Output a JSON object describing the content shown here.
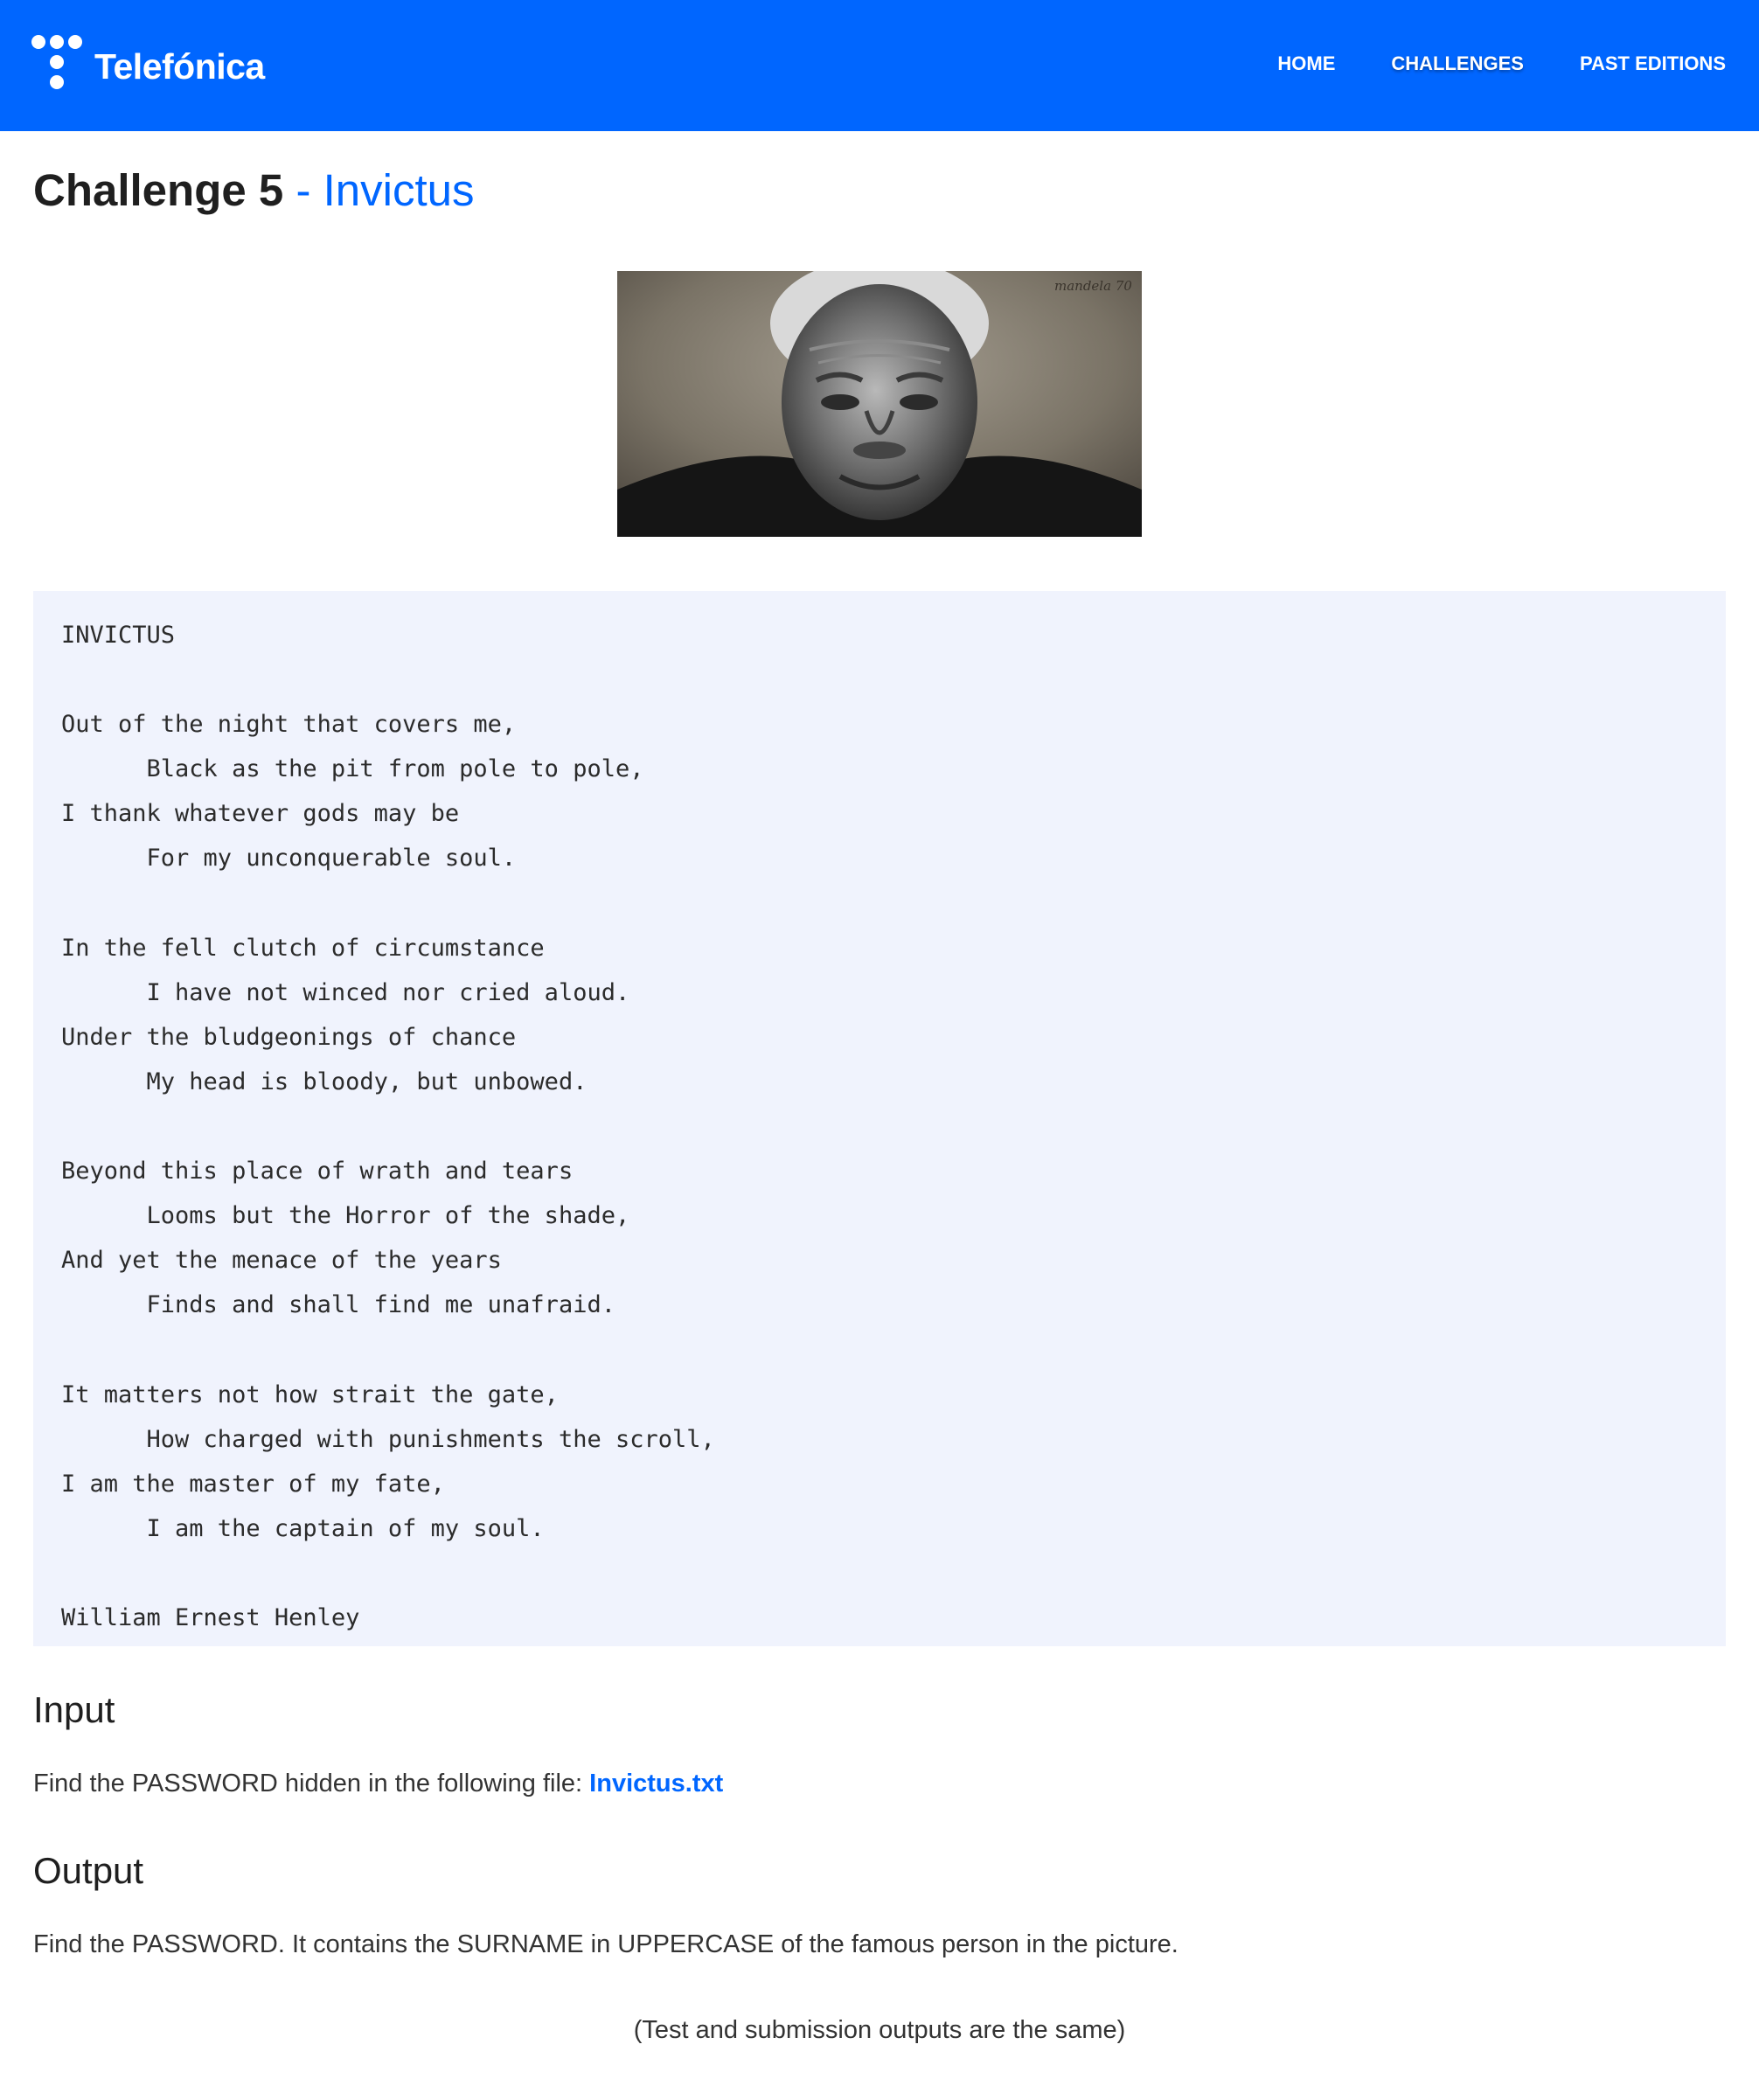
{
  "header": {
    "brand": "Telefónica",
    "nav": [
      "HOME",
      "CHALLENGES",
      "PAST EDITIONS"
    ],
    "active_nav": "CHALLENGES",
    "brand_color": "#0066ff"
  },
  "challenge": {
    "title": "Challenge 5",
    "separator": "-",
    "name": "Invictus"
  },
  "image": {
    "signature": "mandela 70"
  },
  "poem": {
    "text": "INVICTUS\n\nOut of the night that covers me,\n      Black as the pit from pole to pole,\nI thank whatever gods may be\n      For my unconquerable soul.\n\nIn the fell clutch of circumstance\n      I have not winced nor cried aloud.\nUnder the bludgeonings of chance\n      My head is bloody, but unbowed.\n\nBeyond this place of wrath and tears\n      Looms but the Horror of the shade,\nAnd yet the menace of the years\n      Finds and shall find me unafraid.\n\nIt matters not how strait the gate,\n      How charged with punishments the scroll,\nI am the master of my fate,\n      I am the captain of my soul.\n\nWilliam Ernest Henley"
  },
  "input": {
    "heading": "Input",
    "text": "Find the PASSWORD hidden in the following file: ",
    "file_link": "Invictus.txt"
  },
  "output": {
    "heading": "Output",
    "text": "Find the PASSWORD. It contains the SURNAME in UPPERCASE of the famous person in the picture."
  },
  "note": "(Test and submission outputs are the same)"
}
